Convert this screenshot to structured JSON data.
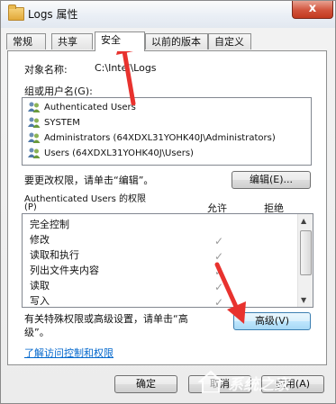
{
  "window": {
    "title": "Logs 属性",
    "close_glyph": "x"
  },
  "tabs": [
    {
      "label": "常规"
    },
    {
      "label": "共享"
    },
    {
      "label": "安全"
    },
    {
      "label": "以前的版本"
    },
    {
      "label": "自定义"
    }
  ],
  "security": {
    "object_label": "对象名称:",
    "object_value": "C:\\Intel\\Logs",
    "group_label": "组或用户名(G):",
    "users": [
      {
        "name": "Authenticated Users",
        "icon": "users-group-icon"
      },
      {
        "name": "SYSTEM",
        "icon": "users-group-icon"
      },
      {
        "name": "Administrators (64XDXL31YOHK40J\\Administrators)",
        "icon": "users-group-icon"
      },
      {
        "name": "Users (64XDXL31YOHK40J\\Users)",
        "icon": "users-group-icon"
      }
    ],
    "change_hint": "要更改权限，请单击“编辑”。",
    "edit_button": "编辑(E)...",
    "perm_title": "Authenticated Users 的权限",
    "perm_p": "(P)",
    "col_allow": "允许",
    "col_deny": "拒绝",
    "permissions": [
      {
        "name": "完全控制",
        "allow": false
      },
      {
        "name": "修改",
        "allow": true
      },
      {
        "name": "读取和执行",
        "allow": true
      },
      {
        "name": "列出文件夹内容",
        "allow": true
      },
      {
        "name": "读取",
        "allow": true
      },
      {
        "name": "写入",
        "allow": true
      }
    ],
    "advanced_hint_1": "有关特殊权限或高级设置，请单击“高",
    "advanced_hint_2": "级”。",
    "advanced_button": "高级(V)",
    "link_text": "了解访问控制和权限"
  },
  "footer": {
    "ok": "确定",
    "cancel": "取消",
    "apply": "应用(A)"
  },
  "watermark": "系统之家",
  "colors": {
    "annotation_arrow": "#e8322e",
    "link": "#0066cc"
  }
}
